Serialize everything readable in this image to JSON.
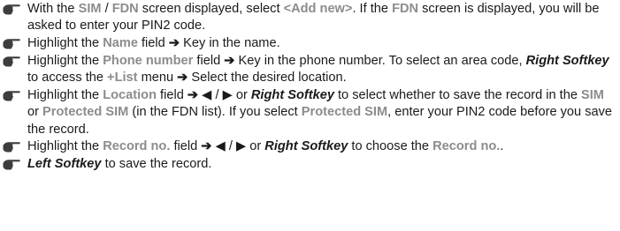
{
  "items": [
    {
      "segments": [
        {
          "t": "With the ",
          "s": ""
        },
        {
          "t": "SIM",
          "s": "g"
        },
        {
          "t": " / ",
          "s": ""
        },
        {
          "t": "FDN",
          "s": "g"
        },
        {
          "t": " screen displayed, select ",
          "s": ""
        },
        {
          "t": "<Add new>",
          "s": "g"
        },
        {
          "t": ". If the ",
          "s": ""
        },
        {
          "t": "FDN",
          "s": "g"
        },
        {
          "t": " screen is displayed, you will be asked to enter your PIN2 code.",
          "s": ""
        }
      ]
    },
    {
      "segments": [
        {
          "t": "Highlight the ",
          "s": ""
        },
        {
          "t": "Name",
          "s": "g"
        },
        {
          "t": " field ",
          "s": ""
        },
        {
          "t": "➔",
          "s": "arr"
        },
        {
          "t": " Key in the name.",
          "s": ""
        }
      ]
    },
    {
      "segments": [
        {
          "t": "Highlight the ",
          "s": ""
        },
        {
          "t": "Phone number",
          "s": "g"
        },
        {
          "t": " field ",
          "s": ""
        },
        {
          "t": "➔",
          "s": "arr"
        },
        {
          "t": " Key in the phone number. To select an area code, ",
          "s": ""
        },
        {
          "t": "Right Softkey",
          "s": "bi"
        },
        {
          "t": " to access the ",
          "s": ""
        },
        {
          "t": "+List",
          "s": "g"
        },
        {
          "t": " menu ",
          "s": ""
        },
        {
          "t": "➔",
          "s": "arr"
        },
        {
          "t": " Select the desired location.",
          "s": ""
        }
      ]
    },
    {
      "segments": [
        {
          "t": "Highlight the ",
          "s": ""
        },
        {
          "t": "Location",
          "s": "g"
        },
        {
          "t": " field ",
          "s": ""
        },
        {
          "t": "➔",
          "s": "arr"
        },
        {
          "t": " ◀ / ▶ or ",
          "s": ""
        },
        {
          "t": "Right Softkey",
          "s": "bi"
        },
        {
          "t": " to select whether to save the record in the ",
          "s": ""
        },
        {
          "t": "SIM",
          "s": "g"
        },
        {
          "t": " or ",
          "s": ""
        },
        {
          "t": "Protected SIM",
          "s": "g"
        },
        {
          "t": " (in the FDN list). If you select ",
          "s": ""
        },
        {
          "t": "Protected SIM",
          "s": "g"
        },
        {
          "t": ", enter your PIN2 code before you save the record.",
          "s": ""
        }
      ]
    },
    {
      "segments": [
        {
          "t": "Highlight the ",
          "s": ""
        },
        {
          "t": "Record no.",
          "s": "g"
        },
        {
          "t": " field ",
          "s": ""
        },
        {
          "t": "➔",
          "s": "arr"
        },
        {
          "t": " ◀ / ▶ or ",
          "s": ""
        },
        {
          "t": "Right Softkey",
          "s": "bi"
        },
        {
          "t": " to choose the ",
          "s": ""
        },
        {
          "t": "Record no.",
          "s": "g"
        },
        {
          "t": ".",
          "s": ""
        }
      ]
    },
    {
      "segments": [
        {
          "t": "Left Softkey",
          "s": "bi"
        },
        {
          "t": " to save the record.",
          "s": ""
        }
      ]
    }
  ]
}
